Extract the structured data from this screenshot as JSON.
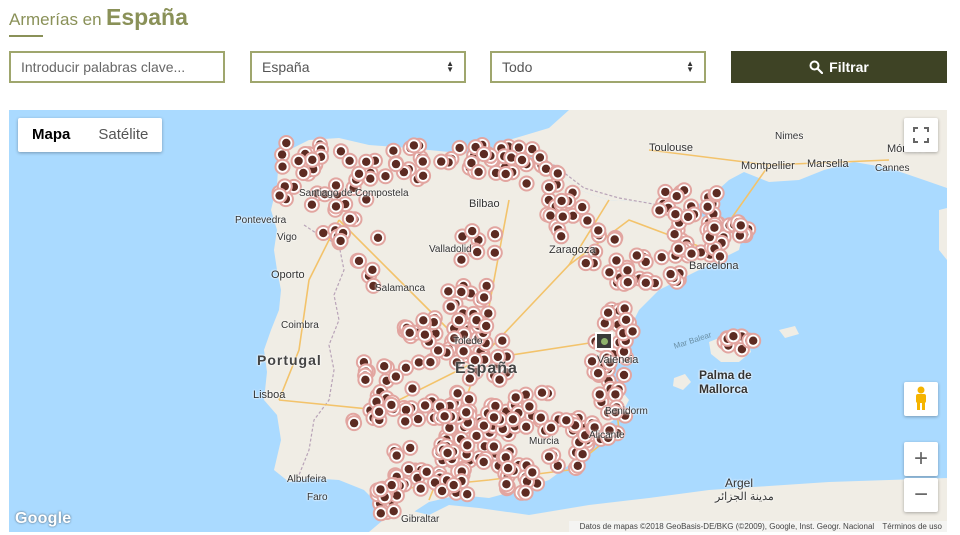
{
  "header": {
    "title_prefix": "Armerías en",
    "title_country": "España"
  },
  "filters": {
    "keywords_placeholder": "Introducir palabras clave...",
    "region_value": "España",
    "category_value": "Todo",
    "filter_button_label": "Filtrar"
  },
  "map": {
    "map_type_tabs": [
      "Mapa",
      "Satélite"
    ],
    "active_tab": "Mapa",
    "google_logo": "Google",
    "attribution": "Datos de mapas ©2018 GeoBasis-DE/BKG (©2009), Google, Inst. Geogr. Nacional",
    "terms": "Términos de uso",
    "zoom_in": "+",
    "zoom_out": "−",
    "country_labels": [
      "Portugal",
      "España"
    ],
    "cities": [
      "Toulouse",
      "Nimes",
      "Montpellier",
      "Marsella",
      "Mónaco",
      "Cannes",
      "Bilbao",
      "Zaragoza",
      "Barcelona",
      "Valencia",
      "Palma de",
      "Mallorca",
      "Lisboa",
      "Oporto",
      "Coimbra",
      "Pontevedra",
      "Vigo",
      "Santiago de Compostela",
      "Valladolid",
      "Salamanca",
      "Toledo",
      "Alicante",
      "Benidorm",
      "Murcia",
      "Albufeira",
      "Faro",
      "Gibraltar",
      "Argel",
      "مدينة الجزائر"
    ],
    "sea_label": "Mar Balear",
    "marker_count": 420
  },
  "colors": {
    "brand_olive": "#8a9158",
    "button_dark": "#3e4325",
    "water": "#aadaff",
    "land": "#f0ede5",
    "marker": "#5d2b22",
    "marker_ring": "#e2a5a0"
  }
}
